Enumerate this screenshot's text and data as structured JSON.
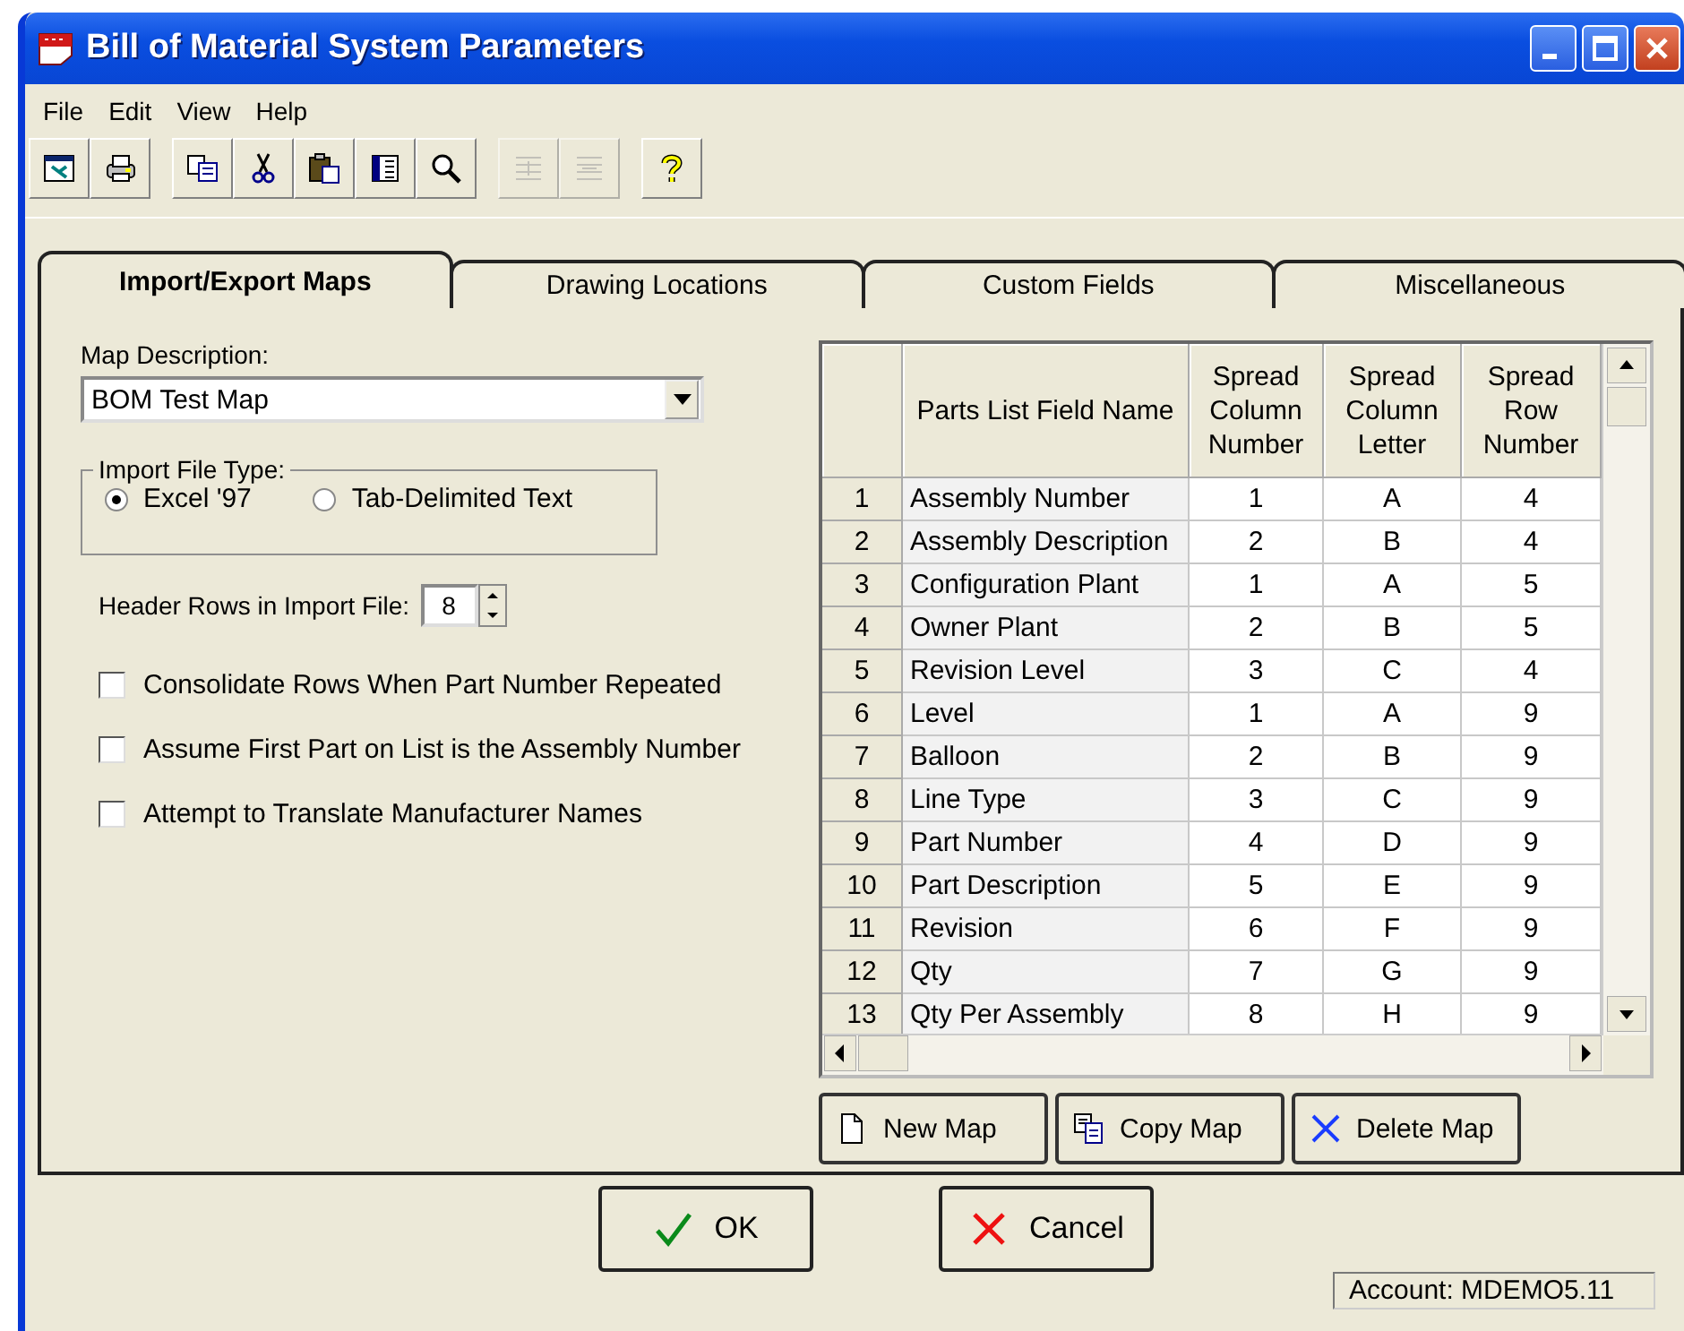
{
  "window": {
    "title": "Bill of Material System Parameters"
  },
  "menu": [
    "File",
    "Edit",
    "View",
    "Help"
  ],
  "toolbar": [
    {
      "kind": "preview",
      "disabled": false
    },
    {
      "kind": "print",
      "disabled": false
    },
    {
      "kind": "copy",
      "disabled": false
    },
    {
      "kind": "cut",
      "disabled": false
    },
    {
      "kind": "paste",
      "disabled": false
    },
    {
      "kind": "columns",
      "disabled": false
    },
    {
      "kind": "zoom",
      "disabled": false
    },
    {
      "kind": "indent",
      "disabled": true
    },
    {
      "kind": "outdent",
      "disabled": true
    },
    {
      "kind": "help",
      "disabled": false
    }
  ],
  "tabs": [
    {
      "label": "Import/Export Maps",
      "selected": true
    },
    {
      "label": "Drawing Locations",
      "selected": false
    },
    {
      "label": "Custom Fields",
      "selected": false
    },
    {
      "label": "Miscellaneous",
      "selected": false
    }
  ],
  "map_description": {
    "label": "Map Description:",
    "value": "BOM Test Map"
  },
  "import_file_type": {
    "label": "Import File Type:",
    "options": [
      {
        "label": "Excel '97",
        "selected": true
      },
      {
        "label": "Tab-Delimited Text",
        "selected": false
      }
    ]
  },
  "header_rows": {
    "label": "Header Rows in Import File:",
    "value": "8"
  },
  "options": [
    {
      "label": "Consolidate Rows When Part Number Repeated",
      "checked": false
    },
    {
      "label": "Assume First Part on List is the Assembly Number",
      "checked": false
    },
    {
      "label": "Attempt to Translate Manufacturer Names",
      "checked": false
    }
  ],
  "table": {
    "columns": [
      "",
      "Parts List Field Name",
      "Spread Column Number",
      "Spread Column Letter",
      "Spread Row Number"
    ],
    "rows": [
      [
        "1",
        "Assembly Number",
        "1",
        "A",
        "4"
      ],
      [
        "2",
        "Assembly Description",
        "2",
        "B",
        "4"
      ],
      [
        "3",
        "Configuration Plant",
        "1",
        "A",
        "5"
      ],
      [
        "4",
        "Owner Plant",
        "2",
        "B",
        "5"
      ],
      [
        "5",
        "Revision Level",
        "3",
        "C",
        "4"
      ],
      [
        "6",
        "Level",
        "1",
        "A",
        "9"
      ],
      [
        "7",
        "Balloon",
        "2",
        "B",
        "9"
      ],
      [
        "8",
        "Line Type",
        "3",
        "C",
        "9"
      ],
      [
        "9",
        "Part Number",
        "4",
        "D",
        "9"
      ],
      [
        "10",
        "Part Description",
        "5",
        "E",
        "9"
      ],
      [
        "11",
        "Revision",
        "6",
        "F",
        "9"
      ],
      [
        "12",
        "Qty",
        "7",
        "G",
        "9"
      ],
      [
        "13",
        "Qty Per Assembly",
        "8",
        "H",
        "9"
      ]
    ]
  },
  "map_buttons": [
    {
      "kind": "new",
      "label": "New Map"
    },
    {
      "kind": "copy",
      "label": "Copy Map"
    },
    {
      "kind": "delete",
      "label": "Delete Map"
    }
  ],
  "dialog_buttons": [
    {
      "kind": "ok",
      "label": "OK"
    },
    {
      "kind": "cancel",
      "label": "Cancel"
    }
  ],
  "status_bar": "Account: MDEMO5.11"
}
